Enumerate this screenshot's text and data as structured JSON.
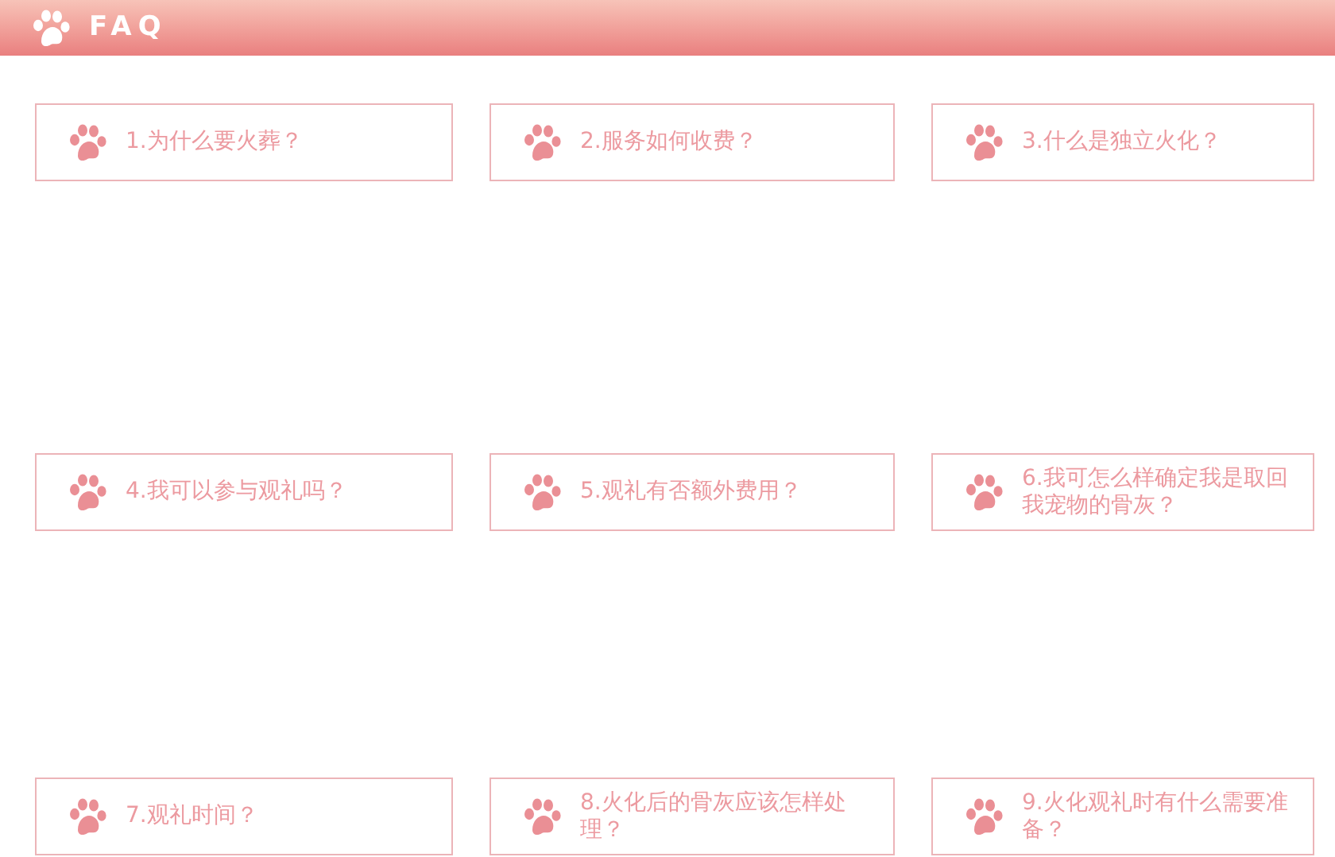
{
  "header": {
    "title": "FAQ"
  },
  "faq_items": [
    {
      "label": "1.为什么要火葬？"
    },
    {
      "label": "2.服务如何收费？"
    },
    {
      "label": "3.什么是独立火化？"
    },
    {
      "label": "4.我可以参与观礼吗？"
    },
    {
      "label": "5.观礼有否额外费用？"
    },
    {
      "label": "6.我可怎么样确定我是取回我宠物的骨灰？"
    },
    {
      "label": "7.观礼时间？"
    },
    {
      "label": "8.火化后的骨灰应该怎样处理？"
    },
    {
      "label": "9.火化观礼时有什么需要准备？"
    }
  ]
}
